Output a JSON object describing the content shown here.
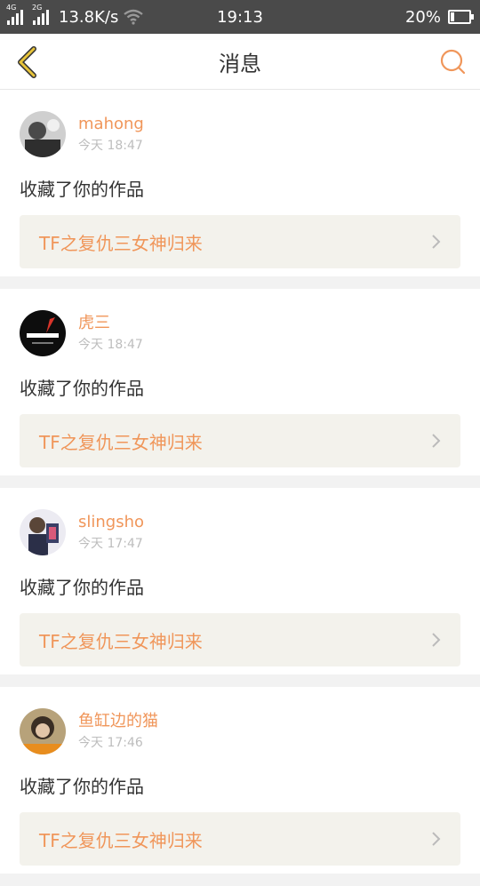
{
  "status_bar": {
    "network_1": "4G",
    "network_2": "2G",
    "speed": "13.8K/s",
    "time": "19:13",
    "battery_percent": "20%",
    "battery_level": 0.2
  },
  "nav": {
    "title": "消息",
    "accent_color": "#f0965a"
  },
  "messages": [
    {
      "username": "mahong",
      "time": "今天 18:47",
      "action": "收藏了你的作品",
      "work_title": "TF之复仇三女神归来"
    },
    {
      "username": "虎三",
      "time": "今天 18:47",
      "action": "收藏了你的作品",
      "work_title": "TF之复仇三女神归来"
    },
    {
      "username": "slingsho",
      "time": "今天 17:47",
      "action": "收藏了你的作品",
      "work_title": "TF之复仇三女神归来"
    },
    {
      "username": "鱼缸边的猫",
      "time": "今天 17:46",
      "action": "收藏了你的作品",
      "work_title": "TF之复仇三女神归来"
    }
  ]
}
